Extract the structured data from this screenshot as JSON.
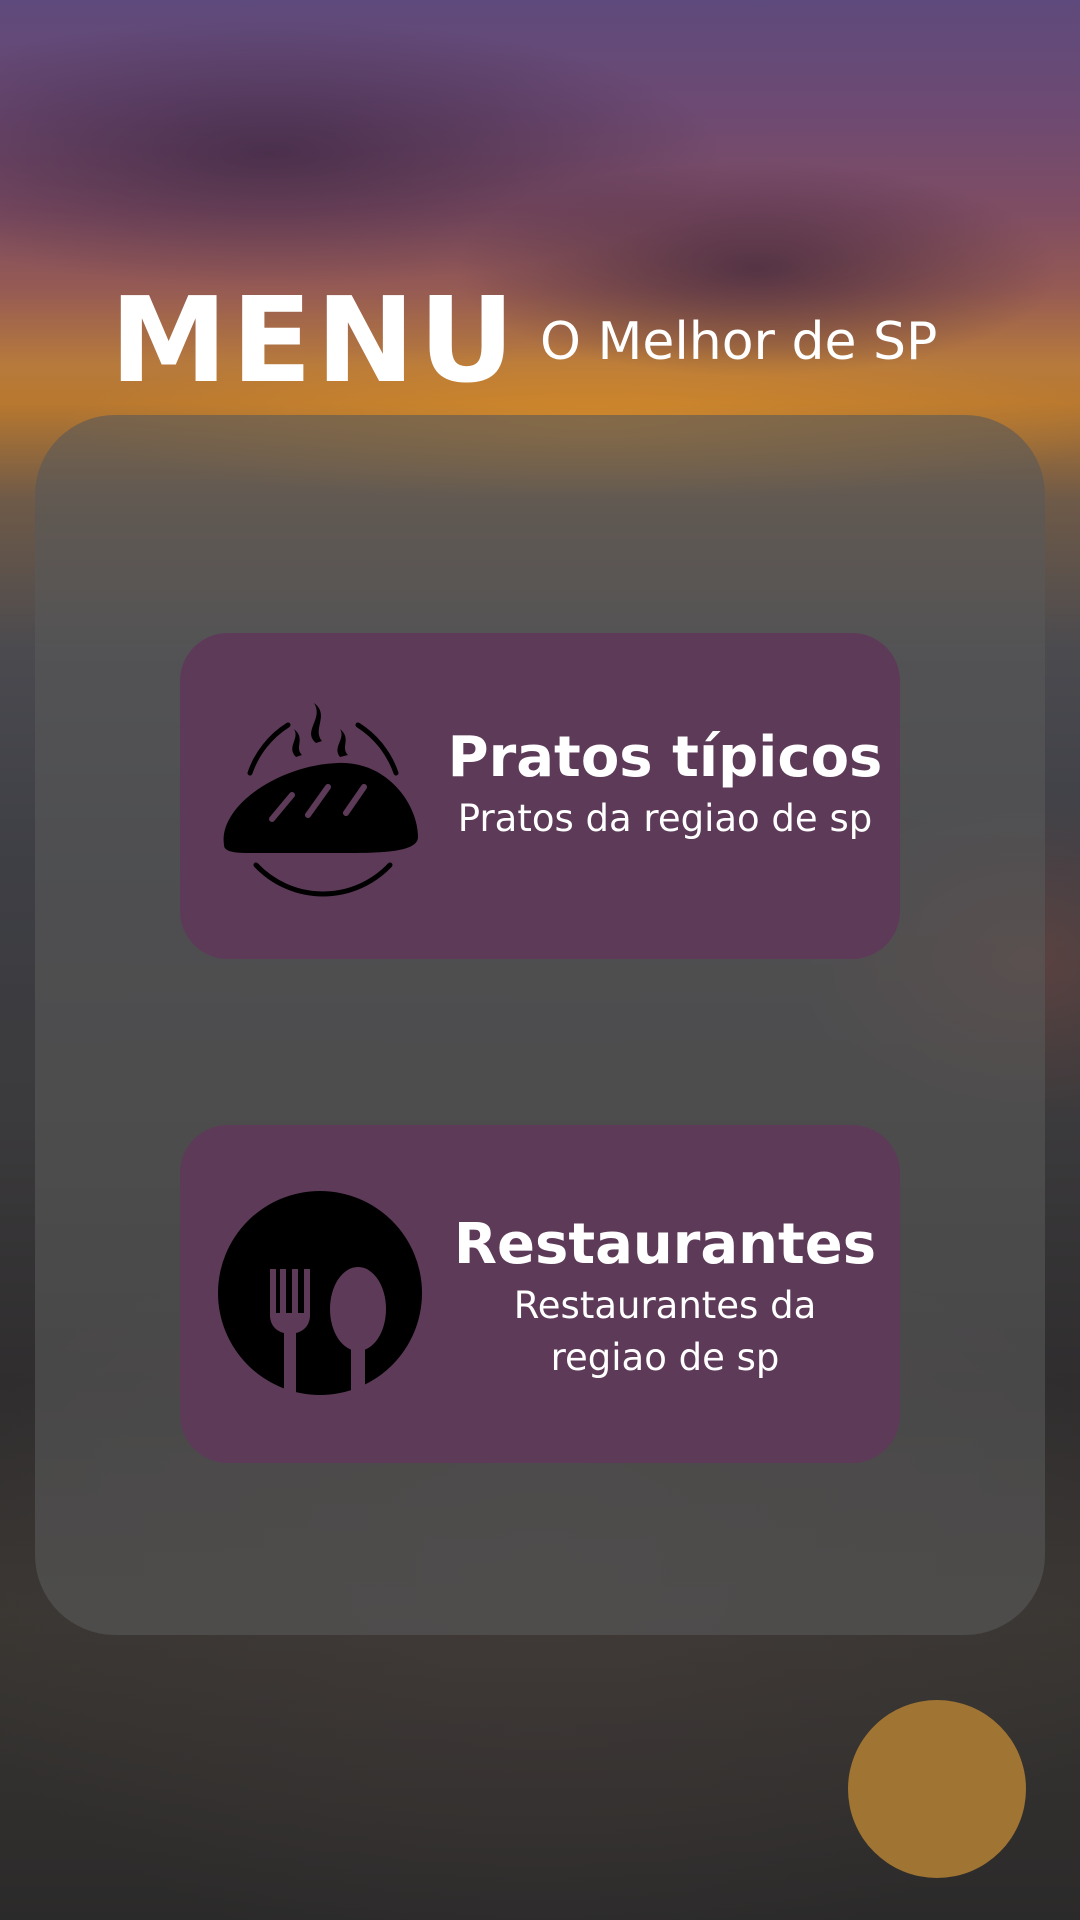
{
  "header": {
    "title": "MENU",
    "subtitle": "O Melhor de SP"
  },
  "cards": [
    {
      "icon": "bread-icon",
      "title": "Pratos típicos",
      "description": "Pratos da regiao de sp"
    },
    {
      "icon": "fork-spoon-icon",
      "title": "Restaurantes",
      "description": "Restaurantes da regiao de sp"
    }
  ],
  "colors": {
    "card_background": "#5d3a58",
    "panel_background": "rgba(88,88,88,0.62)",
    "fab_background": "#a07432",
    "text": "#ffffff",
    "icon": "#000000"
  },
  "fab": {
    "icon": "none"
  }
}
